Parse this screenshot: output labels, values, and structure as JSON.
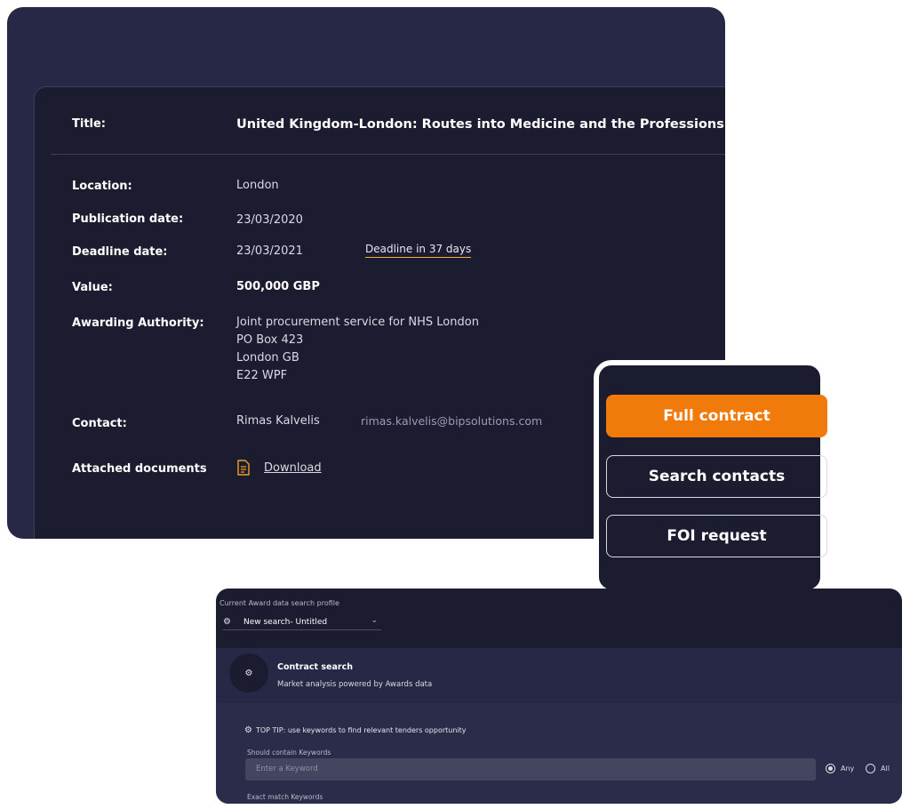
{
  "contract": {
    "rows": {
      "title": {
        "label": "Title:",
        "value": "United Kingdom-London: Routes into Medicine and the Professions - Health Education England"
      },
      "location": {
        "label": "Location:",
        "value": "London"
      },
      "publication": {
        "label": "Publication date:",
        "value": "23/03/2020"
      },
      "deadline": {
        "label": "Deadline date:",
        "value": "23/03/2021",
        "badge": "Deadline in 37 days"
      },
      "value": {
        "label": "Value:",
        "value": "500,000 GBP"
      },
      "authority": {
        "label": "Awarding Authority:",
        "lines": [
          "Joint procurement service for NHS London",
          "PO Box 423",
          "London GB",
          "E22 WPF"
        ]
      },
      "contact": {
        "label": "Contact:",
        "name": "Rimas Kalvelis",
        "email": "rimas.kalvelis@bipsolutions.com"
      },
      "documents": {
        "label": "Attached documents",
        "link": "Download"
      }
    }
  },
  "actions": {
    "full_contract": "Full contract",
    "search_contacts": "Search contacts",
    "foi_request": "FOI request"
  },
  "search_panel": {
    "profile_label": "Current Award data search profile",
    "profile_value": "New search- Untitled",
    "title": "Contract search",
    "subtitle": "Market analysis powered by Awards data",
    "tip": "TOP TIP: use keywords to find relevant tenders opportunity",
    "should_label": "Should contain Keywords",
    "keyword_placeholder": "Enter a Keyword",
    "radio_any": "Any",
    "radio_all": "All",
    "exact_label": "Exact match Keywords"
  },
  "colors": {
    "accent": "#f07a0a",
    "underline": "#f0b23c",
    "panel": "#1b1c30"
  }
}
